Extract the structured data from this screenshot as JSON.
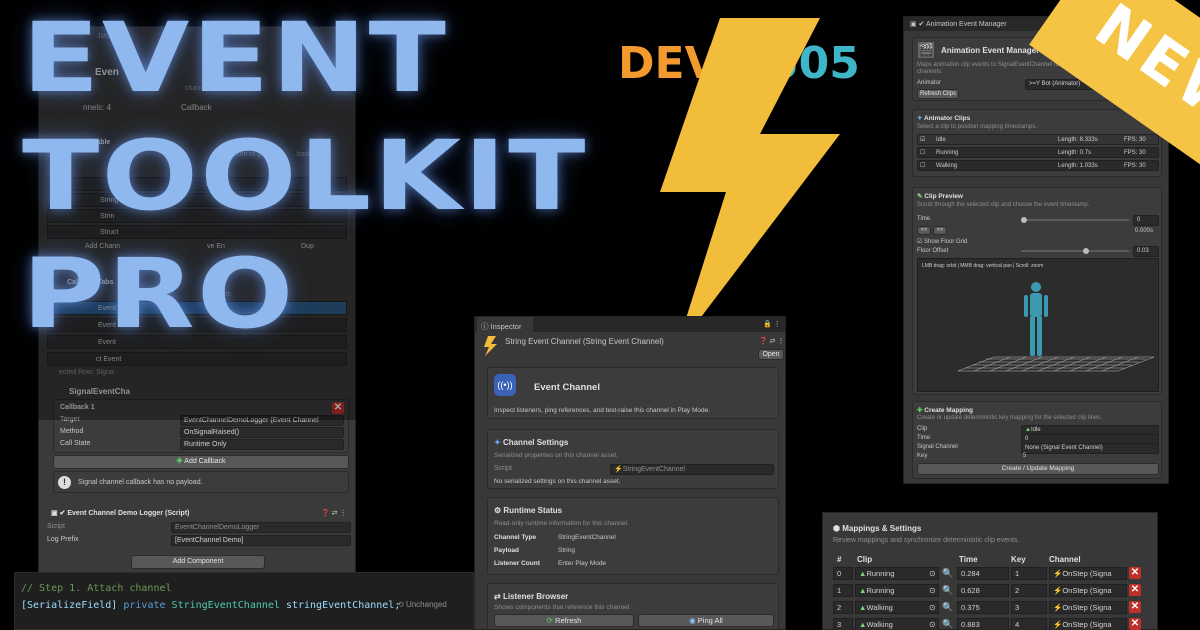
{
  "brand": {
    "dev": "DEV",
    "num": "505",
    "orange": "#f39a2e",
    "teal": "#3fb6c7",
    "bolt": "#f2bd3a"
  },
  "title": {
    "line1": "EVENT",
    "line2": "TOOLKIT",
    "line3": "PRO"
  },
  "new_badge": {
    "label": "NEW",
    "color": "#f6c445"
  },
  "left_panel": {
    "header_label": "Jsto",
    "event_label": "Even",
    "subtitle_fragment": "tals in the u",
    "channel_fragment": "channel",
    "channels_count": "nnels: 4",
    "callback_fragment": "Callback",
    "channel_table_label": "Channel Table",
    "table_hint": "nt column to go",
    "table_hint_end": "backs.",
    "rows": [
      "Even",
      "String",
      "Strin",
      "Struct"
    ],
    "add_channel": "Add Chann",
    "remove_fragment": "ve En",
    "dup_fragment": "Dup",
    "callback_tabs": "Callback Tabs",
    "callback_tabs_hint": "that chec",
    "tab_items": [
      "Event",
      "Event",
      "Event",
      "ct Event"
    ],
    "selected_row": "ected Row: Signa",
    "signal_label": "SignalEventCha",
    "callback1": "Callback 1",
    "target_label": "Target",
    "target_value": "EventChannelDemoLogger (Event Channel",
    "method_label": "Method",
    "method_value": "OnSignalRaised()",
    "call_state_label": "Call State",
    "call_state_value": "Runtime Only",
    "add_callback": "Add Callback",
    "info_text": "Signal channel callback has no payload.",
    "component_title": "Event Channel Demo Logger (Script)",
    "script_label": "Script",
    "script_value": "EventChannelDemoLogger",
    "log_prefix_label": "Log Prefix",
    "log_prefix_value": "[EventChannel Demo]",
    "add_component": "Add Component"
  },
  "code": {
    "comment": "// Step 1. Attach channel",
    "attr": "[SerializeField]",
    "kw": "private",
    "type": "StringEventChannel",
    "ident": "stringEventChannel;",
    "status": "Unchanged"
  },
  "inspector": {
    "tab": "Inspector",
    "title": "String Event Channel (String Event Channel)",
    "open": "Open",
    "event_channel": "Event Channel",
    "event_channel_desc": "Inspect listeners, ping references, and test-raise this channel in Play Mode.",
    "channel_settings": "Channel Settings",
    "channel_settings_desc": "Serialized properties on this channel asset.",
    "script_label": "Script",
    "script_value": "StringEventChannel",
    "no_fields": "No serialized settings on this channel asset.",
    "runtime_status": "Runtime Status",
    "runtime_desc": "Read-only runtime information for this channel.",
    "channel_type_label": "Channel Type",
    "channel_type_value": "StringEventChannel",
    "payload_label": "Payload",
    "payload_value": "String",
    "listener_label": "Listener Count",
    "listener_value": "Enter Play Mode",
    "listener_browser": "Listener Browser",
    "listener_desc": "Shows components that reference this channel.",
    "refresh": "Refresh",
    "ping_all": "Ping All"
  },
  "anim": {
    "window_title": "Animation Event Manager",
    "header": "Animation Event Manager",
    "desc": "Maps animation clip events to SignalEventChannel raises. O",
    "desc2": "channels.",
    "animator_label": "Animator",
    "animator_value": ">=Y Bot (Animator)",
    "refresh_clips": "Refresh Clips",
    "clips_title": "Animator Clips",
    "clips_desc": "Select a clip to position mapping timestamps.",
    "clips": [
      {
        "name": "Idle",
        "length": "Length: 8.333s",
        "fps": "FPS: 30",
        "checked": true
      },
      {
        "name": "Running",
        "length": "Length: 0.7s",
        "fps": "FPS: 30",
        "checked": false
      },
      {
        "name": "Walking",
        "length": "Length: 1.033s",
        "fps": "FPS: 30",
        "checked": false
      }
    ],
    "preview_title": "Clip Preview",
    "preview_desc": "Scrub through the selected clip and choose the event timestamp.",
    "time_label": "Time",
    "time_value": "0",
    "time_readout": "0.000s",
    "prev_btn": "<<",
    "next_btn": ">>",
    "show_floor": "Show Floor Grid",
    "floor_offset_label": "Floor Offset",
    "floor_offset_value": "0.03",
    "viewport_hint": "LMB drag: orbit | MMB drag: vertical pan | Scroll: zoom",
    "create_title": "Create Mapping",
    "create_desc": "Create or update deterministic key mapping for the selected clip lines.",
    "clip_label": "Clip",
    "clip_value": "Idle",
    "time2_label": "Time",
    "time2_value": "0",
    "signal_label": "Signal Channel",
    "signal_value": "None (Signal Event Channel)",
    "key_label": "Key",
    "key_value": "5",
    "create_btn": "Create / Update Mapping"
  },
  "mappings": {
    "title": "Mappings & Settings",
    "desc": "Review mappings and synchronize deterministic clip events.",
    "headers": [
      "#",
      "Clip",
      "Time",
      "Key",
      "Channel"
    ],
    "rows": [
      {
        "idx": "0",
        "clip": "Running",
        "time": "0.284",
        "key": "1",
        "channel": "OnStep (Signa"
      },
      {
        "idx": "1",
        "clip": "Running",
        "time": "0.628",
        "key": "2",
        "channel": "OnStep (Signa"
      },
      {
        "idx": "2",
        "clip": "Walking",
        "time": "0.375",
        "key": "3",
        "channel": "OnStep (Signa"
      },
      {
        "idx": "3",
        "clip": "Walking",
        "time": "0.883",
        "key": "4",
        "channel": "OnStep (Signa"
      }
    ]
  }
}
